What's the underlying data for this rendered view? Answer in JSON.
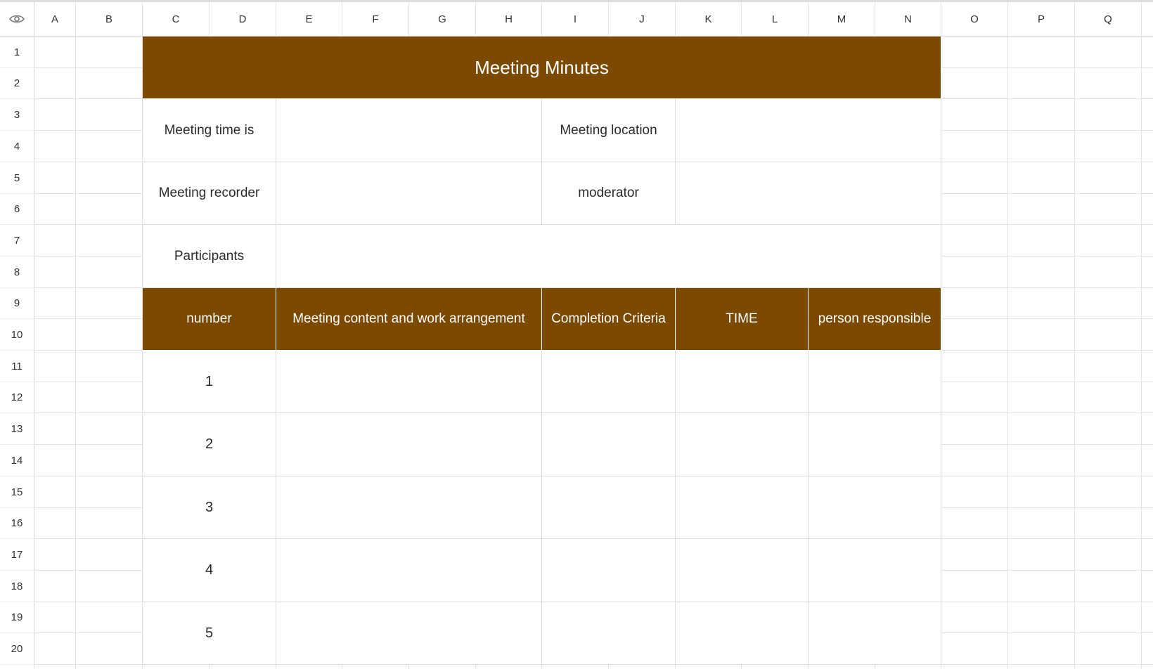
{
  "sheet": {
    "columns": [
      "A",
      "B",
      "C",
      "D",
      "E",
      "F",
      "G",
      "H",
      "I",
      "J",
      "K",
      "L",
      "M",
      "N",
      "O",
      "P",
      "Q"
    ],
    "rows": [
      "1",
      "2",
      "3",
      "4",
      "5",
      "6",
      "7",
      "8",
      "9",
      "10",
      "11",
      "12",
      "13",
      "14",
      "15",
      "16",
      "17",
      "18",
      "19",
      "20"
    ],
    "corner_icon": "eye-icon"
  },
  "colors": {
    "header_fill": "#7b4a00",
    "header_text": "#ffffff",
    "grid_line": "#e2e2e2"
  },
  "form": {
    "title": "Meeting Minutes",
    "meeting_time_label": "Meeting time is",
    "meeting_time_value": "",
    "meeting_location_label": "Meeting location",
    "meeting_location_value": "",
    "meeting_recorder_label": "Meeting recorder",
    "meeting_recorder_value": "",
    "moderator_label": "moderator",
    "moderator_value": "",
    "participants_label": "Participants",
    "participants_value": "",
    "table_headers": {
      "number": "number",
      "content": "Meeting content and work arrangement",
      "criteria": "Completion Criteria",
      "time": "TIME",
      "responsible": "person  responsible"
    },
    "items": [
      {
        "number": "1",
        "content": "",
        "criteria": "",
        "time": "",
        "responsible": ""
      },
      {
        "number": "2",
        "content": "",
        "criteria": "",
        "time": "",
        "responsible": ""
      },
      {
        "number": "3",
        "content": "",
        "criteria": "",
        "time": "",
        "responsible": ""
      },
      {
        "number": "4",
        "content": "",
        "criteria": "",
        "time": "",
        "responsible": ""
      },
      {
        "number": "5",
        "content": "",
        "criteria": "",
        "time": "",
        "responsible": ""
      }
    ]
  }
}
